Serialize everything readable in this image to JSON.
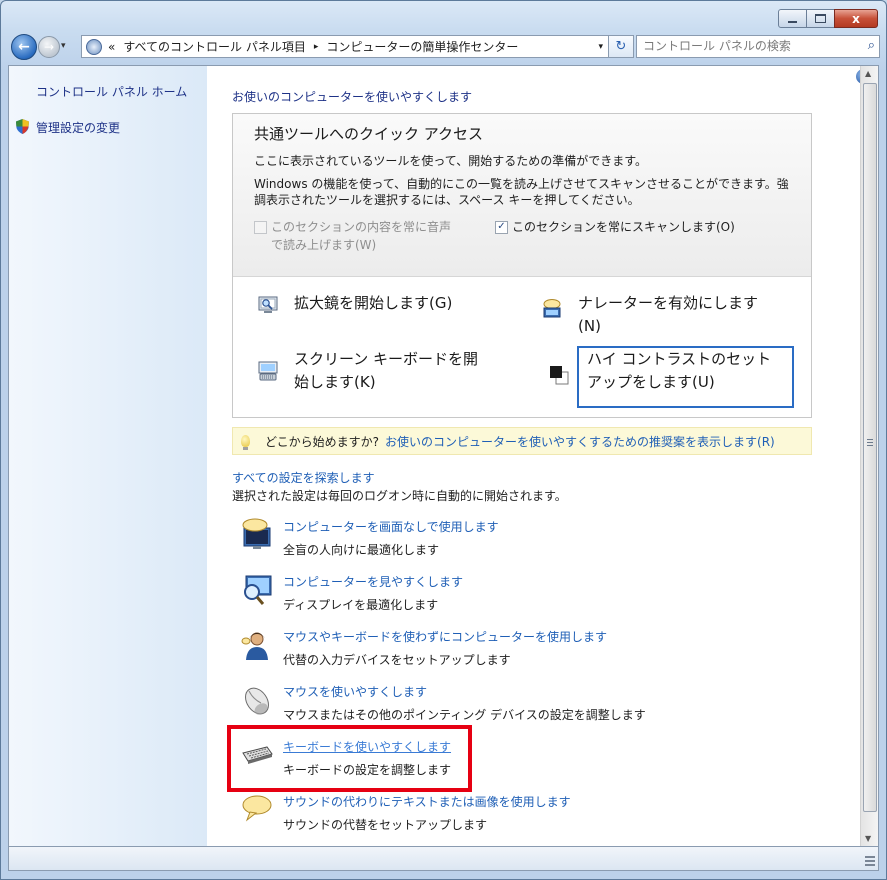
{
  "window": {
    "minimize_icon": "minimize-icon",
    "maximize_icon": "maximize-icon",
    "close_label": "x"
  },
  "nav": {
    "back_glyph": "←",
    "forward_glyph": "→",
    "history_glyph": "▾",
    "crumb_prefix": "«",
    "crumbs": [
      "すべてのコントロール パネル項目",
      "コンピューターの簡単操作センター"
    ],
    "crumb_separator": "▸",
    "address_dropdown": "▾",
    "refresh_glyph": "↻",
    "search_placeholder": "コントロール パネルの検索",
    "search_glyph": "⌕"
  },
  "sidebar": {
    "home_label": "コントロール パネル ホーム",
    "admin_label": "管理設定の変更"
  },
  "main": {
    "help_label": "?",
    "header_link": "お使いのコンピューターを使いやすくします",
    "quick": {
      "title": "共通ツールへのクイック アクセス",
      "desc1": "ここに表示されているツールを使って、開始するための準備ができます。",
      "desc2": "Windows の機能を使って、自動的にこの一覧を読み上げさせてスキャンさせることができます。強調表示されたツールを選択するには、スペース キーを押してください。",
      "read_aloud_line1": "このセクションの内容を常に音声",
      "read_aloud_line2": "で読み上げます(W)",
      "read_aloud_checked": false,
      "scan_label": "このセクションを常にスキャンします(O)",
      "scan_check_glyph": "✓",
      "scan_checked": true,
      "tools": {
        "magnifier": "拡大鏡を開始します(G)",
        "narrator_line1": "ナレーターを有効にします",
        "narrator_line2": "(N)",
        "osk_line1": "スクリーン キーボードを開",
        "osk_line2": "始します(K)",
        "contrast_line1": "ハイ コントラストのセット",
        "contrast_line2": "アップをします(U)"
      }
    },
    "tip": {
      "prefix": "どこから始めますか?",
      "link": "お使いのコンピューターを使いやすくするための推奨案を表示します(R)"
    },
    "settings": {
      "link": "すべての設定を探索します",
      "desc": "選択された設定は毎回のログオン時に自動的に開始されます。",
      "items": [
        {
          "title": "コンピューターを画面なしで使用します",
          "sub": "全盲の人向けに最適化します",
          "icon": "monitor-speech-icon"
        },
        {
          "title": "コンピューターを見やすくします",
          "sub": "ディスプレイを最適化します",
          "icon": "monitor-magnifier-icon"
        },
        {
          "title": "マウスやキーボードを使わずにコンピューターを使用します",
          "sub": "代替の入力デバイスをセットアップします",
          "icon": "person-speech-icon"
        },
        {
          "title": "マウスを使いやすくします",
          "sub": "マウスまたはその他のポインティング デバイスの設定を調整します",
          "icon": "mouse-icon"
        },
        {
          "title": "キーボードを使いやすくします",
          "sub": "キーボードの設定を調整します",
          "icon": "keyboard-icon"
        },
        {
          "title": "サウンドの代わりにテキストまたは画像を使用します",
          "sub": "サウンドの代替をセットアップします",
          "icon": "speech-bubble-icon"
        }
      ]
    }
  },
  "scrollbar": {
    "up_glyph": "▲",
    "down_glyph": "▼"
  },
  "colors": {
    "link": "#1f5fb6",
    "highlight_border": "#e60012",
    "focus_border": "#2a6cc4"
  }
}
